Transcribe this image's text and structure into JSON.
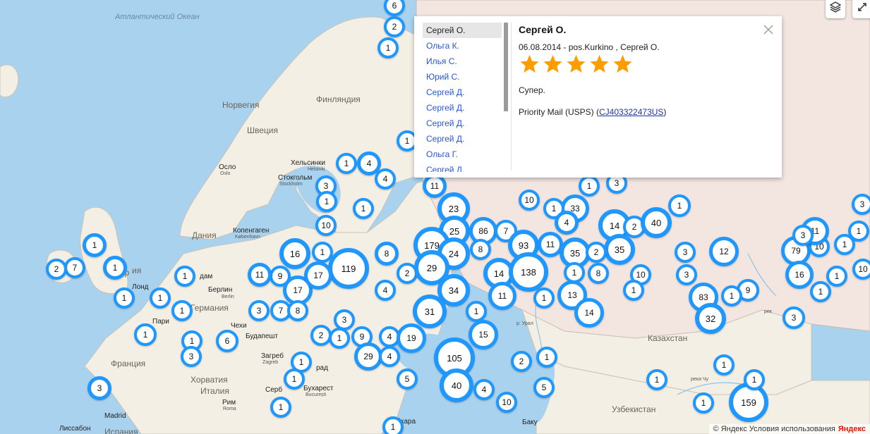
{
  "map": {
    "labels": [
      {
        "id": "ocean-atlantic",
        "type": "ocean",
        "text": "Атлантический Океан"
      },
      {
        "id": "country-norway",
        "type": "country",
        "text": "Норвегия"
      },
      {
        "id": "country-sweden",
        "type": "country",
        "text": "Швеция"
      },
      {
        "id": "country-finland",
        "type": "country",
        "text": "Финляндия"
      },
      {
        "id": "country-denmark",
        "type": "country",
        "text": "Дания"
      },
      {
        "id": "country-germany",
        "type": "country",
        "text": "Германия"
      },
      {
        "id": "country-france",
        "type": "country",
        "text": "Франция"
      },
      {
        "id": "country-italy",
        "type": "country",
        "text": "Италия"
      },
      {
        "id": "country-croatia",
        "type": "country",
        "text": "Хорватия"
      },
      {
        "id": "country-spain",
        "type": "country",
        "text": "Испания"
      },
      {
        "id": "country-kazakhstan",
        "type": "country",
        "text": "Казахстан"
      },
      {
        "id": "country-uzbekistan",
        "type": "country",
        "text": "Узбекистан"
      },
      {
        "id": "city-oslo",
        "type": "city",
        "text": "Осло"
      },
      {
        "id": "city-oslo-sub",
        "type": "sub",
        "text": "Oslo"
      },
      {
        "id": "city-helsinki",
        "type": "city",
        "text": "Хельсинки"
      },
      {
        "id": "city-helsinki-sub",
        "type": "sub",
        "text": "Helsinki"
      },
      {
        "id": "city-stockholm",
        "type": "city",
        "text": "Стокгольм"
      },
      {
        "id": "city-stockholm-sub",
        "type": "sub",
        "text": "Stockholm"
      },
      {
        "id": "city-copenhagen",
        "type": "city",
        "text": "Копенгаген"
      },
      {
        "id": "city-copenhagen-sub",
        "type": "sub",
        "text": "København"
      },
      {
        "id": "city-berlin",
        "type": "city",
        "text": "Берлин"
      },
      {
        "id": "city-berlin-sub",
        "type": "sub",
        "text": "Berlin"
      },
      {
        "id": "city-budapest",
        "type": "city",
        "text": "Будапешт"
      },
      {
        "id": "city-zagreb",
        "type": "city",
        "text": "Загреб"
      },
      {
        "id": "city-zagreb-sub",
        "type": "sub",
        "text": "Zagreb"
      },
      {
        "id": "city-bucharest",
        "type": "city",
        "text": "Бухарест"
      },
      {
        "id": "city-bucharest-sub",
        "type": "sub",
        "text": "București"
      },
      {
        "id": "city-rome",
        "type": "city",
        "text": "Рим"
      },
      {
        "id": "city-rome-sub",
        "type": "sub",
        "text": "Roma"
      },
      {
        "id": "city-madrid",
        "type": "city",
        "text": "Madrid"
      },
      {
        "id": "city-lisbon",
        "type": "city",
        "text": "Лиссабон"
      },
      {
        "id": "city-baku",
        "type": "city",
        "text": "Баку"
      },
      {
        "id": "city-london-partial",
        "type": "city",
        "text": "Лонд"
      },
      {
        "id": "city-paris-partial",
        "type": "city",
        "text": "Пари"
      },
      {
        "id": "city-amsterdam-partial",
        "type": "city",
        "text": "дам"
      },
      {
        "id": "city-belgrade-partial",
        "type": "city",
        "text": "рад"
      },
      {
        "id": "city-sofia-partial",
        "type": "city",
        "text": "бкара"
      },
      {
        "id": "river-ural",
        "type": "sub",
        "text": "р. Урал"
      },
      {
        "id": "river-chu",
        "type": "sub",
        "text": "река Чу"
      },
      {
        "id": "river-rek",
        "type": "sub",
        "text": "рек"
      },
      {
        "id": "region-chekh-partial",
        "type": "city",
        "text": "Чехи"
      },
      {
        "id": "region-serb-partial",
        "type": "city",
        "text": "Серб"
      },
      {
        "id": "region-ir-partial",
        "type": "country",
        "text": "Ир"
      },
      {
        "id": "region-ia-partial",
        "type": "country",
        "text": "ия"
      }
    ],
    "markers": [
      "6",
      "2",
      "1",
      "1",
      "1",
      "4",
      "4",
      "3",
      "1",
      "1",
      "10",
      "11",
      "23",
      "25",
      "86",
      "7",
      "10",
      "1",
      "33",
      "1",
      "3",
      "4",
      "14",
      "2",
      "40",
      "1",
      "3",
      "1",
      "1",
      "7",
      "2",
      "1",
      "16",
      "1",
      "119",
      "8",
      "179",
      "24",
      "8",
      "93",
      "11",
      "35",
      "35",
      "2",
      "3",
      "12",
      "79",
      "10",
      "1",
      "10",
      "11",
      "1",
      "1",
      "9",
      "11",
      "17",
      "2",
      "29",
      "14",
      "138",
      "1",
      "8",
      "10",
      "3",
      "16",
      "3",
      "1",
      "1",
      "4",
      "17",
      "1",
      "34",
      "11",
      "13",
      "1",
      "9",
      "83",
      "1",
      "1",
      "1",
      "3",
      "7",
      "8",
      "31",
      "1",
      "14",
      "32",
      "3",
      "6",
      "1",
      "2",
      "3",
      "1",
      "9",
      "4",
      "19",
      "15",
      "1",
      "3",
      "29",
      "4",
      "105",
      "2",
      "1",
      "1",
      "1",
      "1",
      "5",
      "40",
      "4",
      "10",
      "5",
      "1",
      "159",
      "1",
      "1",
      "3",
      "1",
      "1"
    ],
    "controls": {
      "layers_icon": "layers-icon",
      "fullscreen_icon": "expand-icon"
    }
  },
  "balloon": {
    "list": [
      "Сергей О.",
      "Ольга К.",
      "Илья С.",
      "Юрий С.",
      "Сергей Д.",
      "Сергей Д.",
      "Сергей Д.",
      "Сергей Д.",
      "Ольга Г.",
      "Сергей Д."
    ],
    "selected_index": 0,
    "title": "Сергей О.",
    "meta": "06.08.2014 - pos.Kurkino , Сергей О.",
    "rating": 5,
    "rating_max": 5,
    "review": "Супер.",
    "shipping_prefix": "Priority Mail (USPS) (",
    "tracking": "CJ403322473US",
    "shipping_suffix": ")",
    "star_color": "#ff9d00"
  },
  "footer": {
    "copyright": "© Яндекс Условия использования",
    "logo": "Яндекс"
  },
  "colors": {
    "water": "#a9d2ee",
    "land": "#f4efe4",
    "russia": "#f3e6e1",
    "marker_border": "#1e98ff"
  }
}
